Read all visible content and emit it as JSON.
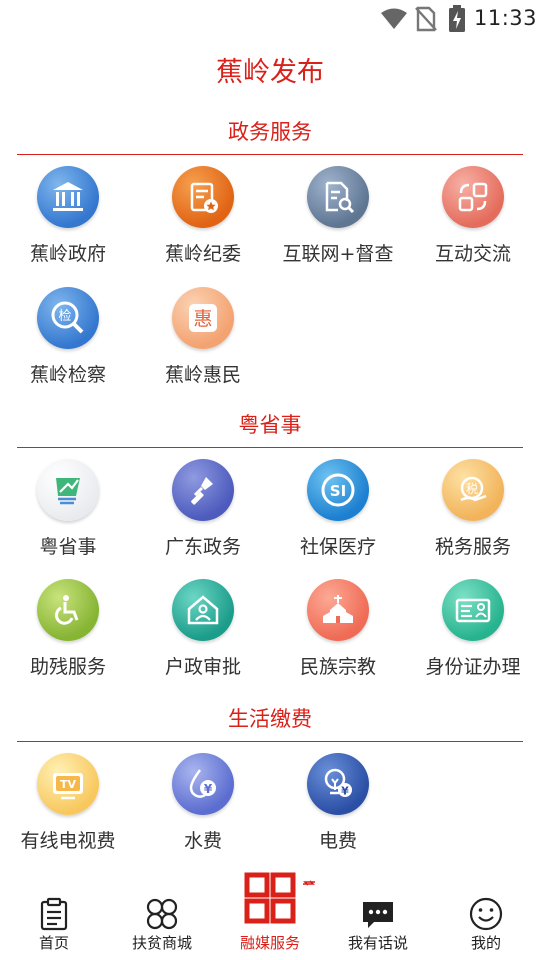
{
  "status_bar": {
    "time": "11:33",
    "icons": [
      "wifi-icon",
      "no-sim-icon",
      "battery-charging-icon"
    ]
  },
  "app_title": "蕉岭发布",
  "accent_color": "#d9211a",
  "sections": [
    {
      "title": "政务服务",
      "items": [
        {
          "label": "蕉岭政府",
          "icon": "government-building-icon"
        },
        {
          "label": "蕉岭纪委",
          "icon": "document-badge-icon"
        },
        {
          "label": "互联网+督查",
          "icon": "document-search-icon"
        },
        {
          "label": "互动交流",
          "icon": "exchange-icon"
        },
        {
          "label": "蕉岭检察",
          "icon": "procuratorate-search-icon",
          "glyph": "检"
        },
        {
          "label": "蕉岭惠民",
          "icon": "benefit-icon",
          "glyph": "惠"
        }
      ]
    },
    {
      "title": "粤省事",
      "items": [
        {
          "label": "粤省事",
          "icon": "yueshengshi-logo-icon"
        },
        {
          "label": "广东政务",
          "icon": "stamp-icon"
        },
        {
          "label": "社保医疗",
          "icon": "social-security-icon",
          "glyph": "SI"
        },
        {
          "label": "税务服务",
          "icon": "tax-icon",
          "glyph": "税"
        },
        {
          "label": "助残服务",
          "icon": "wheelchair-icon"
        },
        {
          "label": "户政审批",
          "icon": "household-icon"
        },
        {
          "label": "民族宗教",
          "icon": "church-icon"
        },
        {
          "label": "身份证办理",
          "icon": "id-card-icon"
        }
      ]
    },
    {
      "title": "生活缴费",
      "items": [
        {
          "label": "有线电视费",
          "icon": "tv-icon",
          "glyph": "TV"
        },
        {
          "label": "水费",
          "icon": "water-drop-icon",
          "glyph": "¥"
        },
        {
          "label": "电费",
          "icon": "light-bulb-icon",
          "glyph": "¥"
        }
      ]
    }
  ],
  "bottom_nav": [
    {
      "label": "首页",
      "icon": "clipboard-icon",
      "active": false
    },
    {
      "label": "扶贫商城",
      "icon": "clover-icon",
      "active": false
    },
    {
      "label": "融媒服务",
      "icon": "grid-squares-icon",
      "active": true
    },
    {
      "label": "我有话说",
      "icon": "chat-bubble-icon",
      "active": false
    },
    {
      "label": "我的",
      "icon": "smiley-icon",
      "active": false
    }
  ]
}
